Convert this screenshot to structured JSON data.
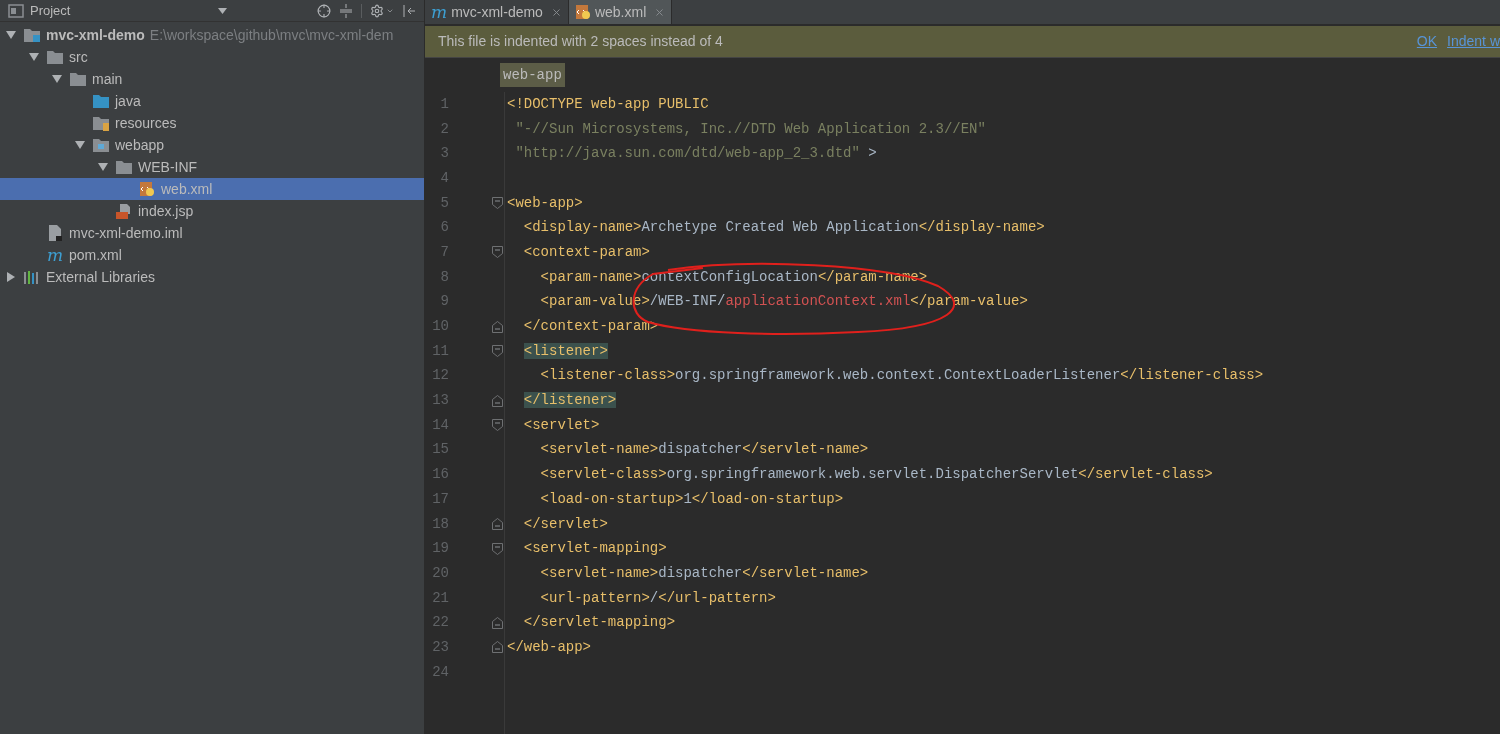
{
  "project_panel": {
    "title": "Project",
    "tree": [
      {
        "label": "mvc-xml-demo",
        "kind": "module",
        "path": "E:\\workspace\\github\\mvc\\mvc-xml-dem",
        "expanded": true,
        "selected": false,
        "children": [
          {
            "label": "src",
            "kind": "folder",
            "expanded": true,
            "selected": false,
            "children": [
              {
                "label": "main",
                "kind": "folder",
                "expanded": true,
                "selected": false,
                "children": [
                  {
                    "label": "java",
                    "kind": "source-folder",
                    "selected": false
                  },
                  {
                    "label": "resources",
                    "kind": "resources-folder",
                    "selected": false
                  },
                  {
                    "label": "webapp",
                    "kind": "web-folder",
                    "expanded": true,
                    "selected": false,
                    "children": [
                      {
                        "label": "WEB-INF",
                        "kind": "folder",
                        "expanded": true,
                        "selected": false,
                        "children": [
                          {
                            "label": "web.xml",
                            "kind": "xml",
                            "selected": true
                          }
                        ]
                      },
                      {
                        "label": "index.jsp",
                        "kind": "jsp",
                        "selected": false
                      }
                    ]
                  }
                ]
              }
            ]
          },
          {
            "label": "mvc-xml-demo.iml",
            "kind": "iml",
            "selected": false
          },
          {
            "label": "pom.xml",
            "kind": "maven",
            "icon_glyph": "m",
            "selected": false
          }
        ]
      },
      {
        "label": "External Libraries",
        "kind": "libraries",
        "expanded": false,
        "selected": false
      }
    ]
  },
  "tabs": [
    {
      "label": "mvc-xml-demo",
      "kind": "maven",
      "icon_glyph": "m",
      "selected": false
    },
    {
      "label": "web.xml",
      "kind": "xml",
      "selected": true
    }
  ],
  "notification": {
    "message": "This file is indented with 2 spaces instead of 4",
    "actions": [
      "OK",
      "Indent w"
    ]
  },
  "breadcrumb": "web-app",
  "code_lines": [
    {
      "number": "1",
      "kind": "plain",
      "tokens": [
        {
          "t": "<!DOCTYPE web-app PUBLIC",
          "kind": "tag"
        }
      ]
    },
    {
      "number": "2",
      "kind": "plain",
      "tokens": [
        {
          "t": " \"-//Sun Microsystems, Inc.//DTD Web Application 2.3//EN\"",
          "kind": "string"
        }
      ]
    },
    {
      "number": "3",
      "kind": "plain",
      "tokens": [
        {
          "t": " \"http://java.sun.com/dtd/web-app_2_3.dtd\"",
          "kind": "string"
        },
        {
          "t": " >",
          "kind": "text"
        }
      ]
    },
    {
      "number": "4",
      "kind": "plain"
    },
    {
      "number": "5",
      "kind": "fold-start",
      "tokens": [
        {
          "t": "<web-app>",
          "kind": "tag"
        }
      ]
    },
    {
      "number": "6",
      "kind": "plain",
      "tokens": [
        {
          "t": "  <display-name>",
          "kind": "tag"
        },
        {
          "t": "Archetype Created Web Application",
          "kind": "text"
        },
        {
          "t": "</display-name>",
          "kind": "tag"
        }
      ]
    },
    {
      "number": "7",
      "kind": "fold-start",
      "tokens": [
        {
          "t": "  <context-param>",
          "kind": "tag"
        }
      ]
    },
    {
      "number": "8",
      "kind": "plain",
      "tokens": [
        {
          "t": "    <param-name>",
          "kind": "tag"
        },
        {
          "t": "contextConfigLocation",
          "kind": "text"
        },
        {
          "t": "</param-name>",
          "kind": "tag"
        }
      ]
    },
    {
      "number": "9",
      "kind": "plain",
      "tokens": [
        {
          "t": "    <param-value>",
          "kind": "tag"
        },
        {
          "t": "/WEB-INF/",
          "kind": "text"
        },
        {
          "t": "applicationContext.xml",
          "kind": "error"
        },
        {
          "t": "</param-value>",
          "kind": "tag"
        }
      ]
    },
    {
      "number": "10",
      "kind": "fold-end",
      "tokens": [
        {
          "t": "  </context-param>",
          "kind": "tag"
        }
      ]
    },
    {
      "number": "11",
      "kind": "fold-start",
      "tokens": [
        {
          "t": "  <listener>",
          "kind": "matched"
        }
      ]
    },
    {
      "number": "12",
      "kind": "plain",
      "tokens": [
        {
          "t": "    <listener-class>",
          "kind": "tag"
        },
        {
          "t": "org.springframework.web.context.ContextLoaderListener",
          "kind": "text"
        },
        {
          "t": "</listener-class>",
          "kind": "tag"
        }
      ]
    },
    {
      "number": "13",
      "kind": "fold-end",
      "tokens": [
        {
          "t": "  </listener>",
          "kind": "matched"
        }
      ]
    },
    {
      "number": "14",
      "kind": "fold-start",
      "tokens": [
        {
          "t": "  <servlet>",
          "kind": "tag"
        }
      ]
    },
    {
      "number": "15",
      "kind": "plain",
      "tokens": [
        {
          "t": "    <servlet-name>",
          "kind": "tag"
        },
        {
          "t": "dispatcher",
          "kind": "text"
        },
        {
          "t": "</servlet-name>",
          "kind": "tag"
        }
      ]
    },
    {
      "number": "16",
      "kind": "plain",
      "tokens": [
        {
          "t": "    <servlet-class>",
          "kind": "tag"
        },
        {
          "t": "org.springframework.web.servlet.DispatcherServlet",
          "kind": "text"
        },
        {
          "t": "</servlet-class>",
          "kind": "tag"
        }
      ]
    },
    {
      "number": "17",
      "kind": "plain",
      "tokens": [
        {
          "t": "    <load-on-startup>",
          "kind": "tag"
        },
        {
          "t": "1",
          "kind": "text"
        },
        {
          "t": "</load-on-startup>",
          "kind": "tag"
        }
      ]
    },
    {
      "number": "18",
      "kind": "fold-end",
      "tokens": [
        {
          "t": "  </servlet>",
          "kind": "tag"
        }
      ]
    },
    {
      "number": "19",
      "kind": "fold-start",
      "tokens": [
        {
          "t": "  <servlet-mapping>",
          "kind": "tag"
        }
      ]
    },
    {
      "number": "20",
      "kind": "plain",
      "tokens": [
        {
          "t": "    <servlet-name>",
          "kind": "tag"
        },
        {
          "t": "dispatcher",
          "kind": "text"
        },
        {
          "t": "</servlet-name>",
          "kind": "tag"
        }
      ]
    },
    {
      "number": "21",
      "kind": "plain",
      "tokens": [
        {
          "t": "    <url-pattern>",
          "kind": "tag"
        },
        {
          "t": "/",
          "kind": "text"
        },
        {
          "t": "</url-pattern>",
          "kind": "tag"
        }
      ]
    },
    {
      "number": "22",
      "kind": "fold-end",
      "tokens": [
        {
          "t": "  </servlet-mapping>",
          "kind": "tag"
        }
      ]
    },
    {
      "number": "23",
      "kind": "fold-end",
      "tokens": [
        {
          "t": "</web-app>",
          "kind": "tag"
        }
      ]
    },
    {
      "number": "24",
      "kind": "plain"
    }
  ],
  "annotations": [
    {
      "kind": "ellipse"
    }
  ]
}
